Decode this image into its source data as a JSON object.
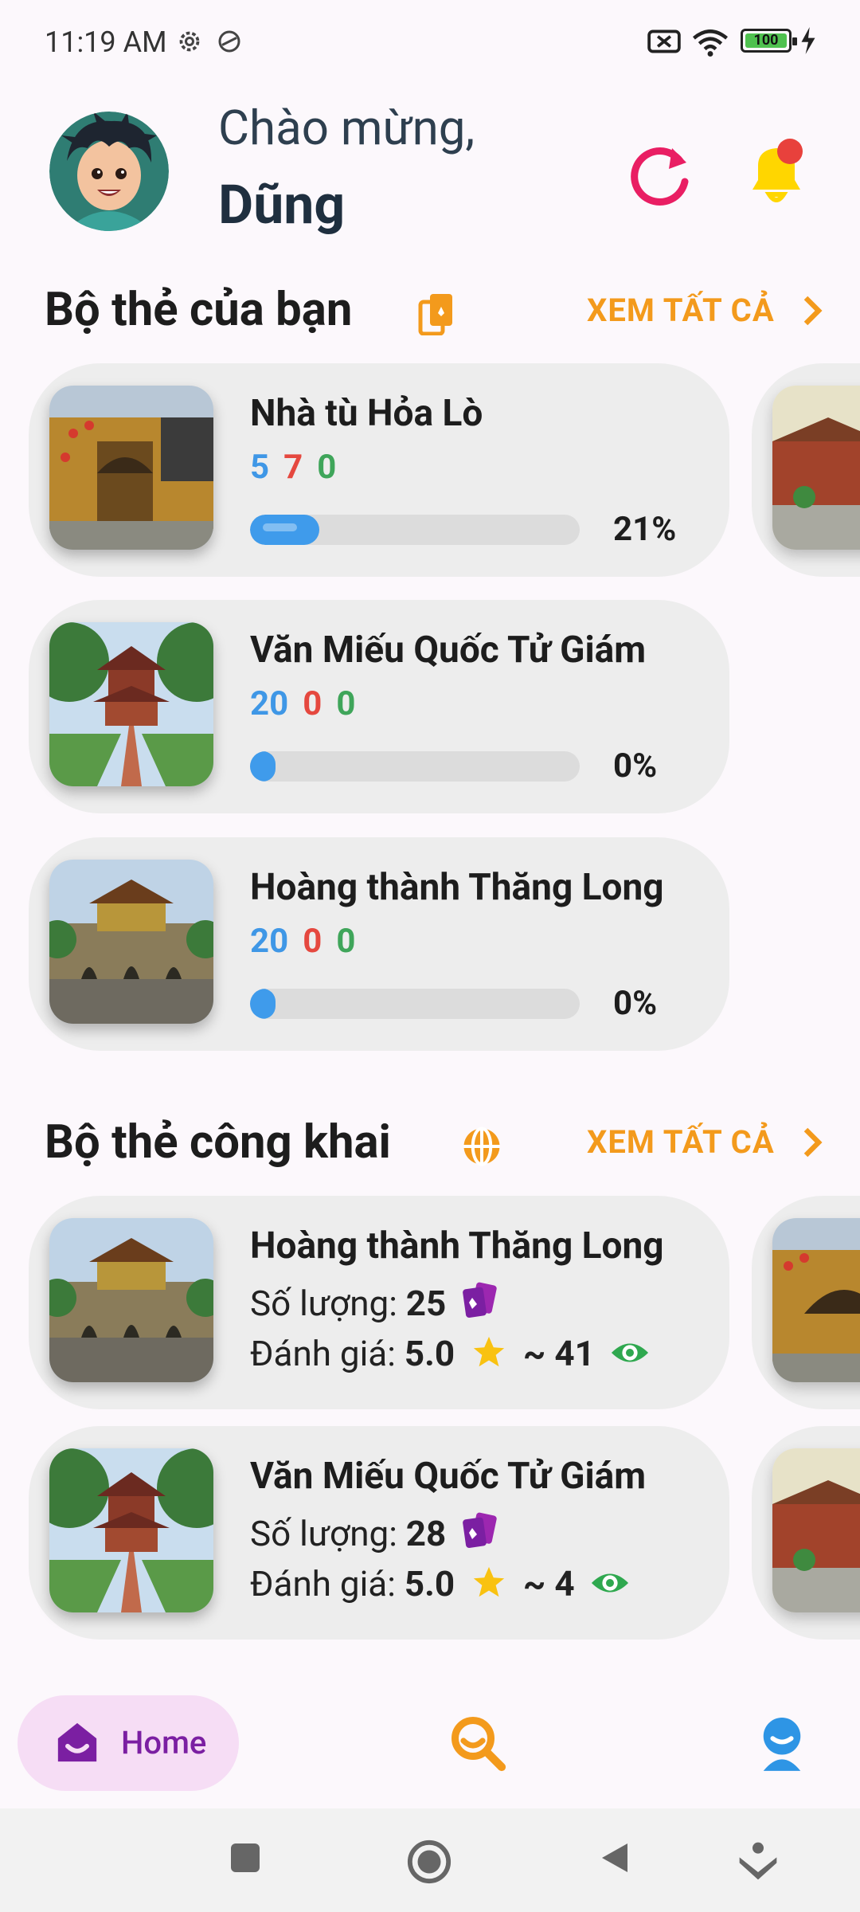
{
  "status": {
    "time": "11:19 AM",
    "battery": "100"
  },
  "header": {
    "greeting": "Chào mừng,",
    "name": "Dũng"
  },
  "my_decks": {
    "title": "Bộ thẻ của bạn",
    "see_all": "XEM TẤT CẢ",
    "items": [
      {
        "name": "Nhà tù Hỏa Lò",
        "blue": "5",
        "red": "7",
        "green": "0",
        "progress": 21,
        "percent": "21%"
      },
      {
        "name": "Văn Miếu Quốc Tử Giám",
        "blue": "20",
        "red": "0",
        "green": "0",
        "progress": 0,
        "percent": "0%"
      },
      {
        "name": "Hoàng thành Thăng Long",
        "blue": "20",
        "red": "0",
        "green": "0",
        "progress": 0,
        "percent": "0%"
      }
    ]
  },
  "public_decks": {
    "title": "Bộ thẻ công khai",
    "see_all": "XEM TẤT CẢ",
    "count_label": "Số lượng:",
    "rating_label": "Đánh giá:",
    "items": [
      {
        "name": "Hoàng thành Thăng Long",
        "count": "25",
        "rating": "5.0",
        "views": "~ 41"
      },
      {
        "name": "Văn Miếu Quốc Tử Giám",
        "count": "28",
        "rating": "5.0",
        "views": "~ 4"
      }
    ]
  },
  "nav": {
    "home_label": "Home"
  },
  "colors": {
    "accent": "#F39A1C",
    "home_purple": "#7B1FA2",
    "progress": "#3F9BEB",
    "refresh": "#E91E63",
    "bell": "#FFD600"
  }
}
